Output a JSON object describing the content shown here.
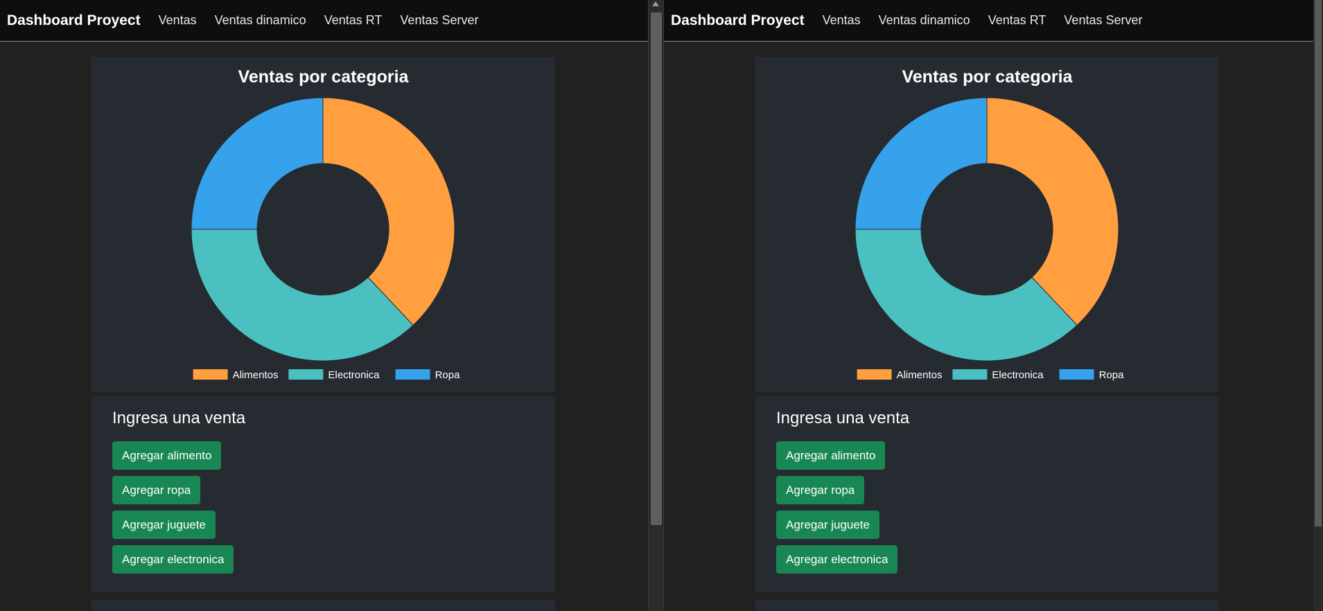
{
  "navbar": {
    "brand": "Dashboard Proyect",
    "links": [
      "Ventas",
      "Ventas dinamico",
      "Ventas RT",
      "Ventas Server"
    ]
  },
  "chart_card": {
    "title": "Ventas por categoria"
  },
  "chart_data": {
    "type": "pie",
    "subtype": "doughnut",
    "title": "Ventas por categoria",
    "categories": [
      "Alimentos",
      "Electronica",
      "Ropa"
    ],
    "values": [
      38,
      37,
      25
    ],
    "colors": [
      "#ff9f40",
      "#4bc0c0",
      "#36a2eb"
    ],
    "legend": "bottom"
  },
  "form_card": {
    "title": "Ingresa una venta",
    "buttons": [
      "Agregar alimento",
      "Agregar ropa",
      "Agregar juguete",
      "Agregar electronica"
    ]
  },
  "colors": {
    "page_bg": "#212121",
    "navbar_bg": "#0e0e0e",
    "card_bg": "#262a31",
    "button_bg": "#198754"
  }
}
